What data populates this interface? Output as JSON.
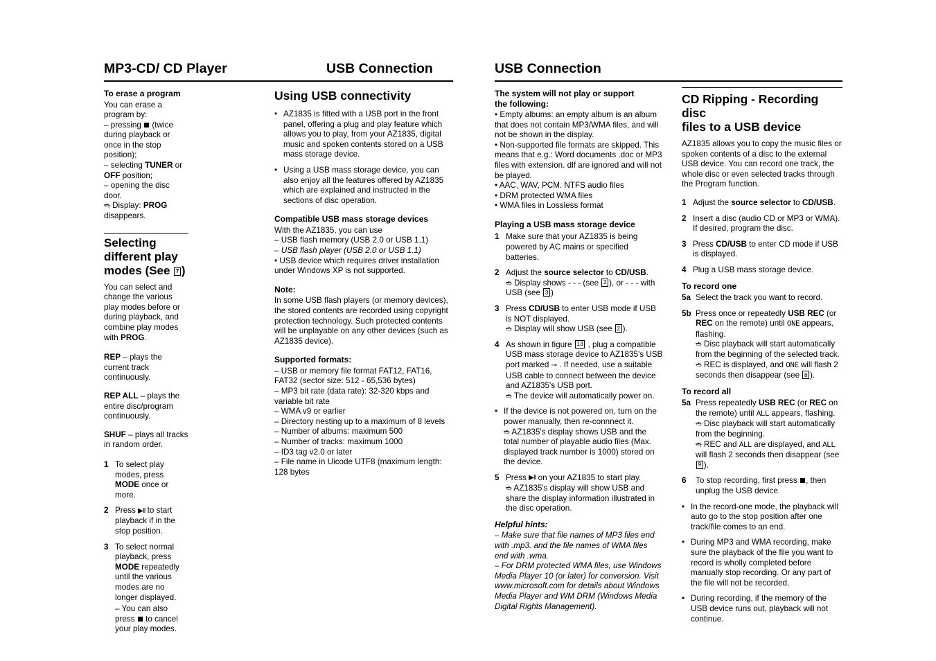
{
  "headers": {
    "left_title": "MP3-CD/ CD Player",
    "mid_title": "USB Connection",
    "right_title": "USB Connection"
  },
  "col1": {
    "erase_title": "To erase a program",
    "erase_intro": "You can erase a program by:",
    "erase_items": [
      "– pressing ■ (twice during playback or once in the stop position);",
      "– selecting TUNER or OFF position;",
      "– opening the disc door."
    ],
    "erase_arrow": "➜ Display: PROG disappears.",
    "play_modes_title_1": "Selecting different play",
    "play_modes_title_2": "modes (See 7 )",
    "play_modes_intro": "You can select and change the various play modes before or during playback, and combine play modes with PROG.",
    "defs": [
      {
        "term": "REP",
        "desc": "– plays the current track continuously."
      },
      {
        "term": "REP ALL",
        "desc": "– plays the entire disc/program continuously."
      },
      {
        "term": "SHUF",
        "desc": "– plays all tracks in random order."
      }
    ],
    "steps": [
      {
        "n": "1",
        "text": "To select play modes, press MODE once or more."
      },
      {
        "n": "2",
        "text": "Press ▶II to start playback if in the stop position."
      },
      {
        "n": "3",
        "text": "To select normal playback, press MODE repeatedly until the various modes are no longer displayed."
      }
    ],
    "step3_sub": "– You can also press ■ to cancel your play modes."
  },
  "col2": {
    "section_title": "Using USB connectivity",
    "bullets": [
      "AZ1835 is fitted with a USB port in the front panel, offering a plug and play feature which allows you to play, from your AZ1835, digital music and spoken contents stored on a USB mass storage device.",
      "Using a USB mass storage device, you can also enjoy all the features offered by AZ1835 which are explained and instructed in the sections of disc operation."
    ],
    "compat_title": "Compatible USB mass storage devices",
    "compat_intro": "With the AZ1835, you can use",
    "compat_items": [
      "– USB flash memory (USB 2.0 or USB 1.1)",
      "– USB flash player (USB 2.0 or USB 1.1)"
    ],
    "compat_bullet": "• USB device which requires driver installation under Windows XP is not supported.",
    "note_title": "Note:",
    "note_text": "In some USB flash players (or memory devices), the stored contents are recorded using copyright protection technology. Such protected contents will be unplayable on any other devices (such as AZ1835 device).",
    "formats_title": "Supported formats:",
    "formats_items": [
      "– USB or memory file format FAT12, FAT16, FAT32 (sector size: 512 - 65,536 bytes)",
      "– MP3 bit rate (data rate): 32-320 kbps and variable bit rate",
      "– WMA v9 or earlier",
      "– Directory nesting up to a maximum of 8 levels",
      "– Number of albums: maximum 500",
      "– Number of tracks: maximum 1000",
      "– ID3 tag v2.0 or later",
      "– File name in Uicode UTF8 (maximum length: 128 bytes"
    ]
  },
  "col3": {
    "nosupport_title_1": "The system will not play or support",
    "nosupport_title_2": "the following:",
    "nosupport_items": [
      "• Empty albums: an empty album is an album that does not contain MP3/WMA files, and will not be shown in the display.",
      "• Non-supported file formats are skipped. This means that e.g.: Word documents .doc or MP3 files with extension. dlf are ignored and will not be played.",
      "• AAC, WAV, PCM. NTFS audio files",
      "• DRM protected WMA files",
      "• WMA files in Lossless format"
    ],
    "playing_title": "Playing a USB mass storage device",
    "steps": [
      {
        "n": "1",
        "text": "Make sure that your AZ1835 is being powered by AC mains or specified batteries."
      },
      {
        "n": "2",
        "text": "Adjust the source selector to CD/USB.",
        "arrows": [
          "➜ Display shows - - - (see 2 ), or - - - with USB (see 3 )"
        ]
      },
      {
        "n": "3",
        "text": "Press CD/USB to enter USB mode if USB is NOT displayed.",
        "arrows": [
          "➜ Display will show USB (see 2 )."
        ]
      },
      {
        "n": "4",
        "text": "As shown in figure 13 , plug a compatible USB mass storage device to AZ1835's USB port marked ⇢ . If needed, use a suitable USB cable to connect between the device and AZ1835's USB port.",
        "arrows": [
          "➜ The device will automatically power on."
        ]
      }
    ],
    "bullet_reconnect": "If the device is not powered on, turn on the power manually, then re-connnect it.",
    "bullet_reconnect_arrow": "➜ AZ1835's display shows USB and the total number of playable audio files (Max. displayed track number is 1000) stored on the device.",
    "step5": {
      "n": "5",
      "text": "Press ▶II on your AZ1835 to start play.",
      "arrow": "➜ AZ1835's display will show USB and share the display information illustrated in the disc operation."
    },
    "hints_title": "Helpful hints:",
    "hints": [
      "– Make sure that file names of MP3 files end with .mp3. and the file names of WMA files end with .wma.",
      "– For DRM protected WMA files, use Windows Media Player 10 (or later) for conversion. Visit www.microsoft.com for details about Windows Media Player and WM DRM (Windows Media Digital Rights Management)."
    ]
  },
  "col4": {
    "title_1": "CD Ripping - Recording disc",
    "title_2": "files to a USB device",
    "intro": "AZ1835 allows you to copy the music files or spoken contents of a disc to the external USB device. You can record one track, the whole disc or even selected tracks through the Program function.",
    "steps": [
      {
        "n": "1",
        "text": "Adjust the source selector to CD/USB."
      },
      {
        "n": "2",
        "text": "Insert a disc (audio CD or MP3 or WMA). If desired, program the disc."
      },
      {
        "n": "3",
        "text": "Press CD/USB to enter CD mode if USB is displayed."
      },
      {
        "n": "4",
        "text": "Plug a USB mass storage device."
      }
    ],
    "rec_one_title": "To record one",
    "rec_one_steps": [
      {
        "n": "5a",
        "text": "Select the track you want to record."
      },
      {
        "n": "5b",
        "text": "Press once or repeatedly USB REC (or REC on the remote) until ONE appears, flashing.",
        "arrows": [
          "➜ Disc playback will start automatically from the beginning of the selected track.",
          "➜ REC is displayed, and ONE will flash 2 seconds then disappear (see 8 )."
        ]
      }
    ],
    "rec_all_title": "To record all",
    "rec_all_steps": [
      {
        "n": "5a",
        "text": "Press repeatedly USB REC (or REC on the remote) until ALL appears, flashing.",
        "arrows": [
          "➜ Disc playback will start automatically from the beginning.",
          "➜ REC and ALL are displayed, and ALL will flash 2 seconds then disappear (see 9 )."
        ]
      },
      {
        "n": "6",
        "text": "To stop recording, first press ■, then unplug the USB device."
      }
    ],
    "bullets": [
      "In the record-one mode, the playback will auto go to the stop position after one track/file comes to an end.",
      "During MP3 and WMA recording, make sure the playback of the file you want to record is wholly completed before manually stop recording. Or any part of the file will not be recorded.",
      "During recording, if the memory of the USB device runs out, playback will not continue."
    ]
  }
}
